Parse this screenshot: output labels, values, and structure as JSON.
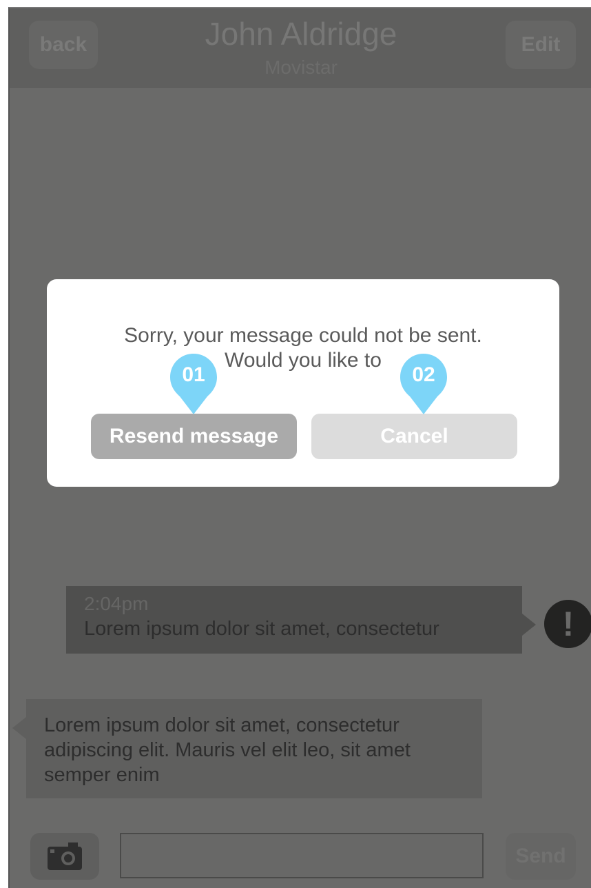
{
  "navbar": {
    "back_label": "back",
    "title": "John Aldridge",
    "subtitle": "Movistar",
    "edit_label": "Edit"
  },
  "messages": {
    "outgoing": {
      "time": "2:04pm",
      "text": "Lorem ipsum dolor sit amet, consectetur",
      "status_icon": "exclamation-icon",
      "status_glyph": "!"
    },
    "incoming": {
      "text": "Lorem ipsum dolor sit amet, consectetur adipiscing elit. Mauris vel elit leo, sit amet semper enim"
    }
  },
  "composer": {
    "camera_icon": "camera-icon",
    "input_value": "",
    "send_label": "Send"
  },
  "dialog": {
    "line1": "Sorry, your message could not be sent.",
    "line2": "Would you like to",
    "resend_label": "Resend message",
    "cancel_label": "Cancel"
  },
  "annotations": [
    {
      "label": "01"
    },
    {
      "label": "02"
    }
  ],
  "colors": {
    "overlay": "#6a6a69",
    "pin": "#7dd5f8",
    "resend_bg": "#aaaaaa",
    "cancel_bg": "#dcdcdc"
  }
}
